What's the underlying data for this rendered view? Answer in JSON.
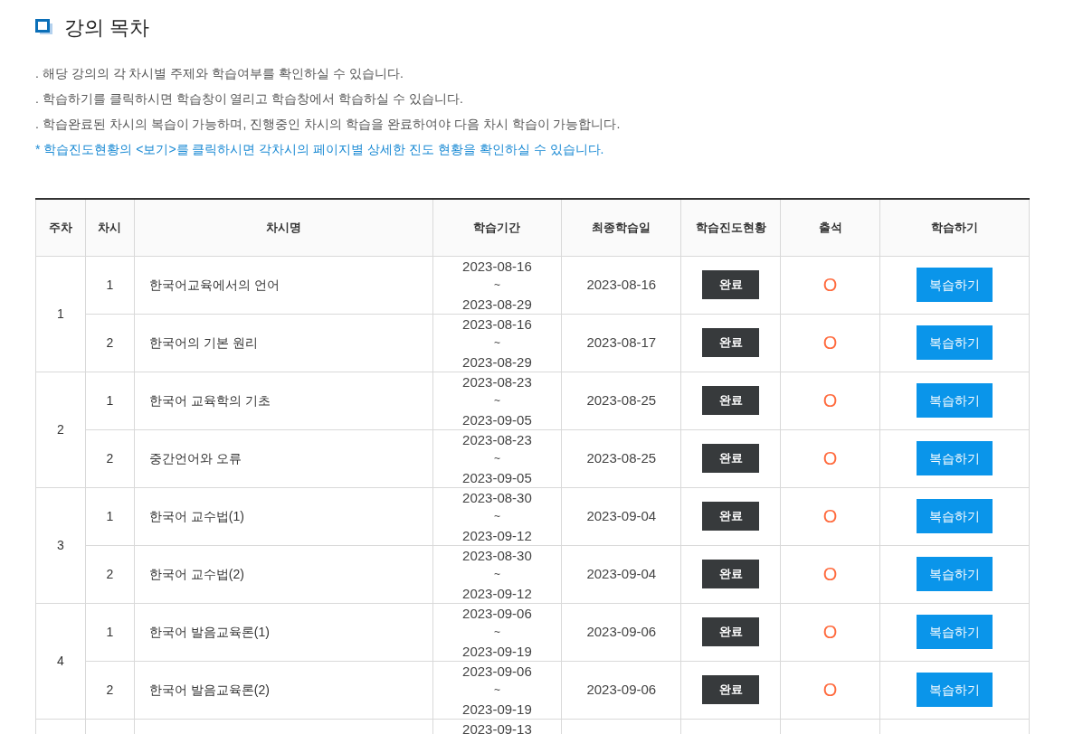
{
  "title": "강의 목차",
  "notices": [
    {
      "kind": "plain",
      "text": ". 해당 강의의 각 차시별 주제와 학습여부를 확인하실 수 있습니다."
    },
    {
      "kind": "plain",
      "text": ". 학습하기를 클릭하시면 학습창이 열리고 학습창에서 학습하실 수 있습니다."
    },
    {
      "kind": "plain",
      "text": ". 학습완료된 차시의 복습이 가능하며, 진행중인 차시의 학습을 완료하여야 다음 차시 학습이 가능합니다."
    },
    {
      "kind": "highlight",
      "text": "* 학습진도현황의 <보기>를 클릭하시면 각차시의 페이지별 상세한 진도 현황을 확인하실 수 있습니다."
    }
  ],
  "table": {
    "columns": [
      "주차",
      "차시",
      "차시명",
      "학습기간",
      "최종학습일",
      "학습진도현황",
      "출석",
      "학습하기"
    ],
    "weeks": [
      {
        "week": "1",
        "sessions": [
          {
            "session": "1",
            "name": "한국어교육에서의 언어",
            "period_start": "2023-08-16",
            "period_separator": "~",
            "period_end": "2023-08-29",
            "last_study": "2023-08-16",
            "progress": "완료",
            "attendance": "O",
            "action": "복습하기"
          },
          {
            "session": "2",
            "name": "한국어의 기본 원리",
            "period_start": "2023-08-16",
            "period_separator": "~",
            "period_end": "2023-08-29",
            "last_study": "2023-08-17",
            "progress": "완료",
            "attendance": "O",
            "action": "복습하기"
          }
        ]
      },
      {
        "week": "2",
        "sessions": [
          {
            "session": "1",
            "name": "한국어 교육학의 기초",
            "period_start": "2023-08-23",
            "period_separator": "~",
            "period_end": "2023-09-05",
            "last_study": "2023-08-25",
            "progress": "완료",
            "attendance": "O",
            "action": "복습하기"
          },
          {
            "session": "2",
            "name": "중간언어와 오류",
            "period_start": "2023-08-23",
            "period_separator": "~",
            "period_end": "2023-09-05",
            "last_study": "2023-08-25",
            "progress": "완료",
            "attendance": "O",
            "action": "복습하기"
          }
        ]
      },
      {
        "week": "3",
        "sessions": [
          {
            "session": "1",
            "name": "한국어 교수법(1)",
            "period_start": "2023-08-30",
            "period_separator": "~",
            "period_end": "2023-09-12",
            "last_study": "2023-09-04",
            "progress": "완료",
            "attendance": "O",
            "action": "복습하기"
          },
          {
            "session": "2",
            "name": "한국어 교수법(2)",
            "period_start": "2023-08-30",
            "period_separator": "~",
            "period_end": "2023-09-12",
            "last_study": "2023-09-04",
            "progress": "완료",
            "attendance": "O",
            "action": "복습하기"
          }
        ]
      },
      {
        "week": "4",
        "sessions": [
          {
            "session": "1",
            "name": "한국어 발음교육론(1)",
            "period_start": "2023-09-06",
            "period_separator": "~",
            "period_end": "2023-09-19",
            "last_study": "2023-09-06",
            "progress": "완료",
            "attendance": "O",
            "action": "복습하기"
          },
          {
            "session": "2",
            "name": "한국어 발음교육론(2)",
            "period_start": "2023-09-06",
            "period_separator": "~",
            "period_end": "2023-09-19",
            "last_study": "2023-09-06",
            "progress": "완료",
            "attendance": "O",
            "action": "복습하기"
          }
        ]
      },
      {
        "sessions": [
          {
            "period_start": "2023-09-13"
          }
        ]
      }
    ]
  }
}
